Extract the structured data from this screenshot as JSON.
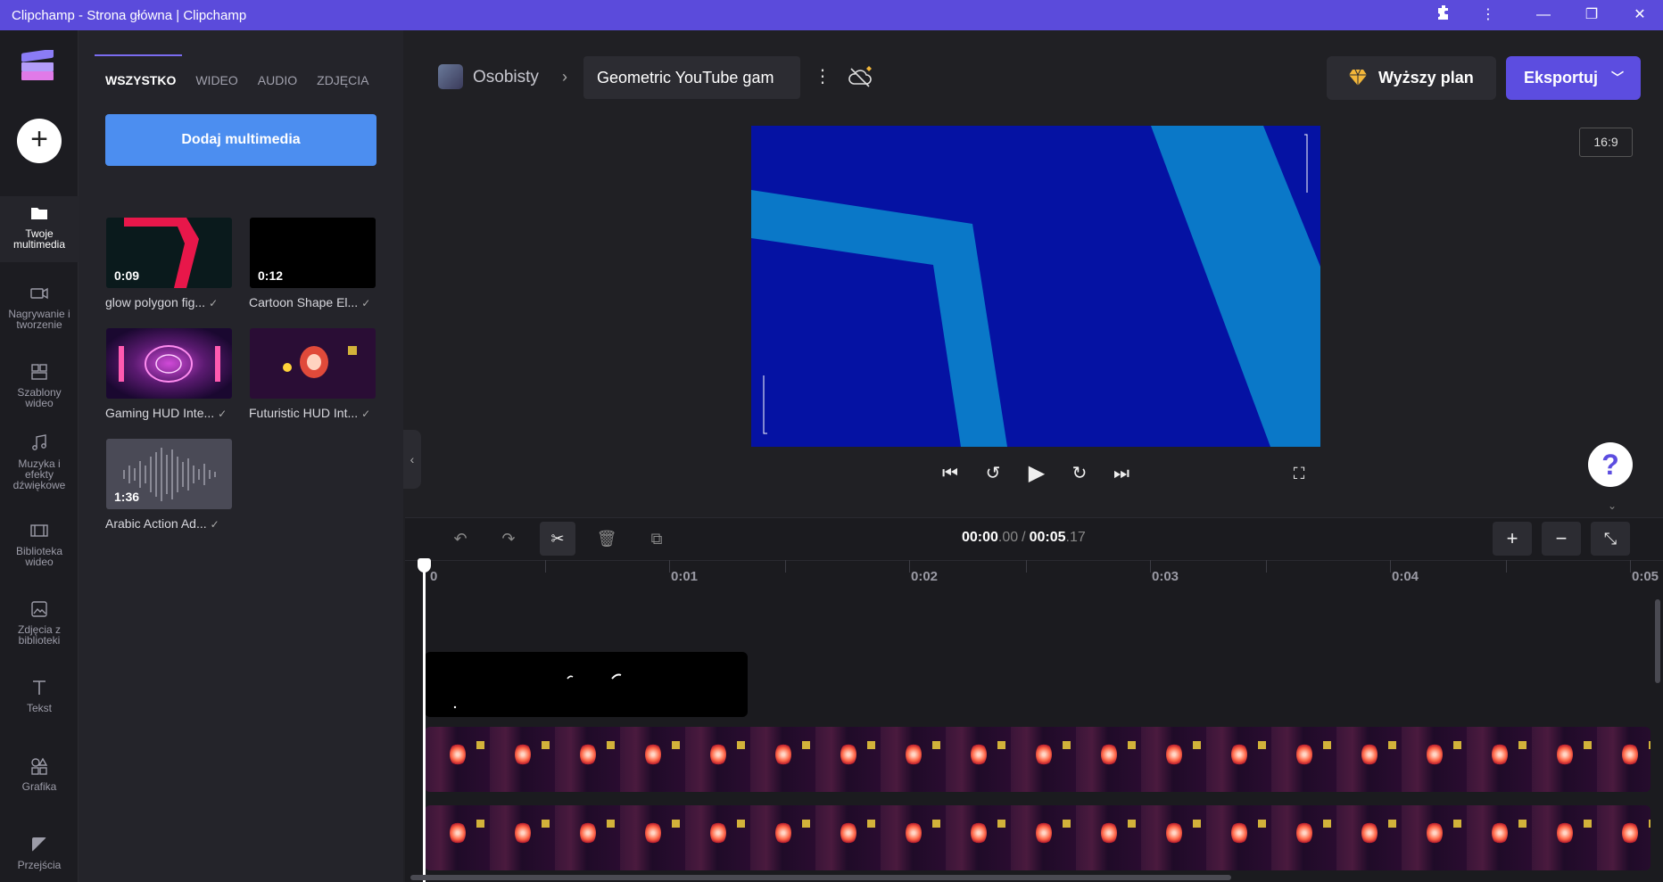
{
  "window": {
    "title": "Clipchamp - Strona główna | Clipchamp"
  },
  "nav": {
    "items": [
      {
        "label": "Twoje multimedia"
      },
      {
        "label": "Nagrywanie i tworzenie"
      },
      {
        "label": "Szablony wideo"
      },
      {
        "label": "Muzyka i efekty dźwiękowe"
      },
      {
        "label": "Biblioteka wideo"
      },
      {
        "label": "Zdjęcia z biblioteki"
      },
      {
        "label": "Tekst"
      },
      {
        "label": "Grafika"
      },
      {
        "label": "Przejścia"
      }
    ]
  },
  "media": {
    "tabs": [
      "WSZYSTKO",
      "WIDEO",
      "AUDIO",
      "ZDJĘCIA"
    ],
    "add_label": "Dodaj multimedia",
    "items": [
      {
        "duration": "0:09",
        "label": "glow polygon fig..."
      },
      {
        "duration": "0:12",
        "label": "Cartoon Shape El..."
      },
      {
        "duration": "",
        "label": "Gaming HUD Inte..."
      },
      {
        "duration": "",
        "label": "Futuristic HUD Int..."
      },
      {
        "duration": "1:36",
        "label": "Arabic Action Ad..."
      }
    ],
    "check": "✓"
  },
  "topbar": {
    "workspace": "Osobisty",
    "project_name": "Geometric YouTube gam",
    "upgrade_label": "Wyższy plan",
    "export_label": "Eksportuj"
  },
  "preview": {
    "aspect_ratio": "16:9"
  },
  "timeline": {
    "current_time_main": "00:00",
    "current_time_frac": ".00",
    "separator": "/",
    "total_time_main": "00:05",
    "total_time_frac": ".17",
    "ruler": [
      "0",
      "0:01",
      "0:02",
      "0:03",
      "0:04",
      "0:05"
    ]
  },
  "colors": {
    "accent": "#5c4de0",
    "add_media": "#4c8ef0",
    "titlebar": "#5b4bdb",
    "preview_bg": "#0512a3",
    "preview_band": "#0a78c8"
  }
}
